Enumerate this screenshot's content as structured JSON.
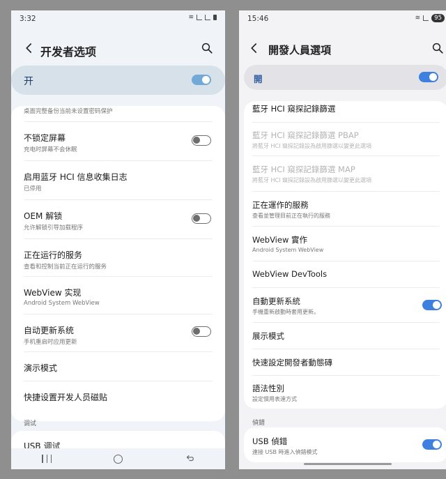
{
  "left": {
    "status": {
      "time": "3:32"
    },
    "title": "开发者选项",
    "master_label": "开",
    "rows": [
      {
        "title": "",
        "subtitle": "桌面完整备份当前未设置密码保护"
      },
      {
        "title": "不锁定屏幕",
        "subtitle": "充电时屏幕不会休眠",
        "toggle": "off"
      },
      {
        "title": "启用蓝牙 HCI 信息收集日志",
        "subtitle": "已停用"
      },
      {
        "title": "OEM 解锁",
        "subtitle": "允许解锁引导加载程序",
        "toggle": "off"
      },
      {
        "title": "正在运行的服务",
        "subtitle": "查看和控制当前正在运行的服务"
      },
      {
        "title": "WebView 实现",
        "subtitle": "Android System WebView"
      },
      {
        "title": "自动更新系统",
        "subtitle": "手机重启时应用更新",
        "toggle": "off"
      },
      {
        "title": "演示模式",
        "subtitle": ""
      },
      {
        "title": "快捷设置开发人员磁贴",
        "subtitle": ""
      }
    ],
    "section_debug": "调试",
    "usb_row": {
      "title": "USB 调试"
    }
  },
  "right": {
    "status": {
      "time": "15:46",
      "battery": "95"
    },
    "title": "開發人員選項",
    "master_label": "開",
    "rows": [
      {
        "title": "藍牙 HCI 窺探記錄篩選",
        "subtitle": "",
        "disabled": false
      },
      {
        "title": "藍牙 HCI 窺探記錄篩選 PBAP",
        "subtitle": "將藍牙 HCI 窺探記錄設為啟用篩選以變更此選項",
        "disabled": true
      },
      {
        "title": "藍牙 HCI 窺探記錄篩選 MAP",
        "subtitle": "將藍牙 HCI 窺探記錄設為啟用篩選以變更此選項",
        "disabled": true
      },
      {
        "title": "正在運作的服務",
        "subtitle": "查看並管理目前正在執行的服務",
        "disabled": false
      },
      {
        "title": "WebView 實作",
        "subtitle": "Android System WebView",
        "disabled": false
      },
      {
        "title": "WebView DevTools",
        "subtitle": "",
        "disabled": false
      },
      {
        "title": "自動更新系統",
        "subtitle": "手機重新啟動時套用更新。",
        "toggle": "on",
        "disabled": false
      },
      {
        "title": "展示模式",
        "subtitle": "",
        "disabled": false
      },
      {
        "title": "快速設定開發者動態磚",
        "subtitle": "",
        "disabled": false
      },
      {
        "title": "語法性別",
        "subtitle": "設定慣用表達方式",
        "disabled": false
      }
    ],
    "section_debug": "偵錯",
    "usb_row": {
      "title": "USB 偵錯",
      "subtitle": "連接 USB 時進入偵錯模式",
      "toggle": "on"
    }
  },
  "colors": {
    "accent_on": "#3e80e0",
    "left_accent_on": "#72a9d6",
    "master_left_bg": "#d6e1ea"
  }
}
